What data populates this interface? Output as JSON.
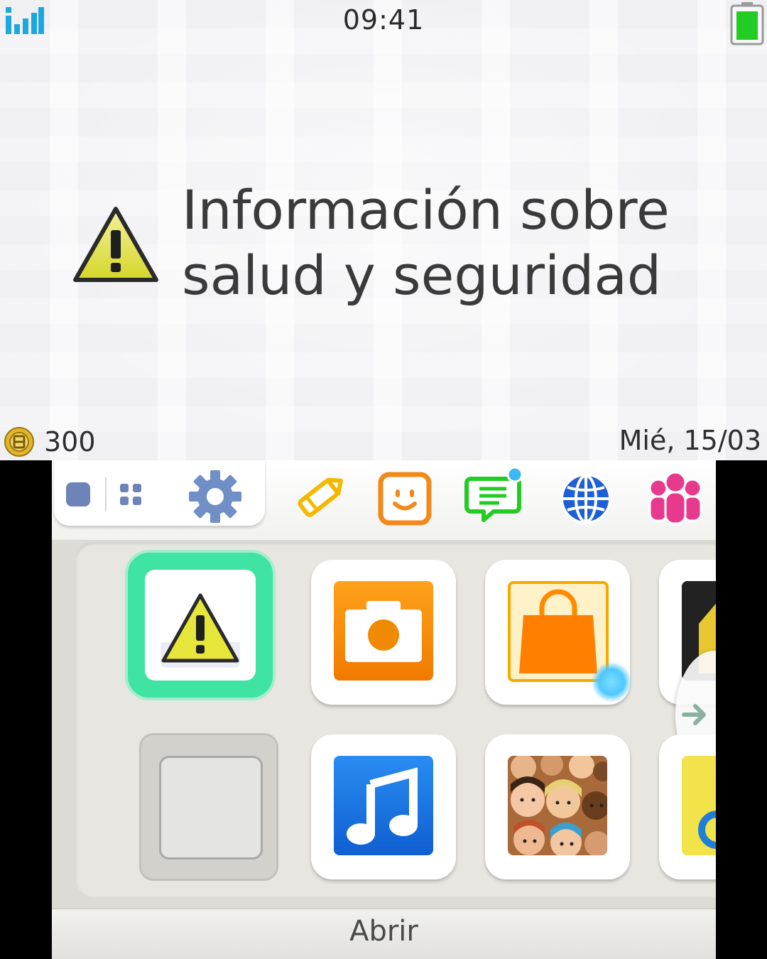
{
  "status_bar": {
    "time": "09:41",
    "signal_icon": "signal-strength-icon",
    "battery_icon": "battery-icon",
    "battery_color": "#22cc22"
  },
  "top_screen": {
    "title_line1": "Información sobre",
    "title_line2": "salud y seguridad",
    "icon": "warning-icon",
    "coins": "300",
    "coin_icon": "play-coin-icon",
    "date": "Mié, 15/03"
  },
  "toolbar": {
    "layout_buttons": [
      "brightness-square-icon",
      "grid-size-icon",
      "settings-gear-icon"
    ],
    "apps": [
      {
        "name": "game-notes-icon",
        "color": "#f5b800"
      },
      {
        "name": "friend-list-icon",
        "color": "#f08a1a"
      },
      {
        "name": "notifications-icon",
        "color": "#22cc22"
      },
      {
        "name": "internet-browser-icon",
        "color": "#1f5fd6"
      },
      {
        "name": "miiverse-icon",
        "color": "#e83a8c"
      }
    ],
    "notification_dot_color": "#3bb8f5"
  },
  "home_grid": {
    "tiles": [
      {
        "name": "health-safety-tile",
        "icon": "warning-icon",
        "selected": true
      },
      {
        "name": "camera-tile",
        "icon": "camera-icon"
      },
      {
        "name": "eshop-tile",
        "icon": "shopping-bag-icon"
      },
      {
        "name": "partial-tile-right-top",
        "icon": "game-cartridge-icon"
      },
      {
        "name": "empty-slot-tile",
        "icon": "empty-slot-icon"
      },
      {
        "name": "sound-tile",
        "icon": "music-note-icon"
      },
      {
        "name": "mii-maker-tile",
        "icon": "mii-faces-icon"
      },
      {
        "name": "partial-tile-right-bottom",
        "icon": "partial-app-icon"
      }
    ],
    "accent_color": "#3fe4a2"
  },
  "bottom_bar": {
    "open_label": "Abrir"
  }
}
